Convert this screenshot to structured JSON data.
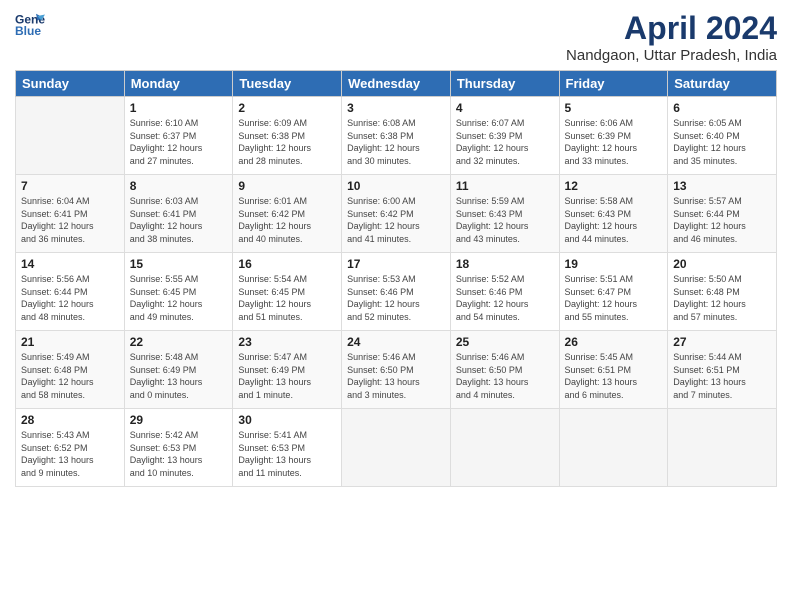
{
  "header": {
    "logo_line1": "General",
    "logo_line2": "Blue",
    "month": "April 2024",
    "location": "Nandgaon, Uttar Pradesh, India"
  },
  "columns": [
    "Sunday",
    "Monday",
    "Tuesday",
    "Wednesday",
    "Thursday",
    "Friday",
    "Saturday"
  ],
  "weeks": [
    [
      {
        "day": "",
        "info": ""
      },
      {
        "day": "1",
        "info": "Sunrise: 6:10 AM\nSunset: 6:37 PM\nDaylight: 12 hours\nand 27 minutes."
      },
      {
        "day": "2",
        "info": "Sunrise: 6:09 AM\nSunset: 6:38 PM\nDaylight: 12 hours\nand 28 minutes."
      },
      {
        "day": "3",
        "info": "Sunrise: 6:08 AM\nSunset: 6:38 PM\nDaylight: 12 hours\nand 30 minutes."
      },
      {
        "day": "4",
        "info": "Sunrise: 6:07 AM\nSunset: 6:39 PM\nDaylight: 12 hours\nand 32 minutes."
      },
      {
        "day": "5",
        "info": "Sunrise: 6:06 AM\nSunset: 6:39 PM\nDaylight: 12 hours\nand 33 minutes."
      },
      {
        "day": "6",
        "info": "Sunrise: 6:05 AM\nSunset: 6:40 PM\nDaylight: 12 hours\nand 35 minutes."
      }
    ],
    [
      {
        "day": "7",
        "info": "Sunrise: 6:04 AM\nSunset: 6:41 PM\nDaylight: 12 hours\nand 36 minutes."
      },
      {
        "day": "8",
        "info": "Sunrise: 6:03 AM\nSunset: 6:41 PM\nDaylight: 12 hours\nand 38 minutes."
      },
      {
        "day": "9",
        "info": "Sunrise: 6:01 AM\nSunset: 6:42 PM\nDaylight: 12 hours\nand 40 minutes."
      },
      {
        "day": "10",
        "info": "Sunrise: 6:00 AM\nSunset: 6:42 PM\nDaylight: 12 hours\nand 41 minutes."
      },
      {
        "day": "11",
        "info": "Sunrise: 5:59 AM\nSunset: 6:43 PM\nDaylight: 12 hours\nand 43 minutes."
      },
      {
        "day": "12",
        "info": "Sunrise: 5:58 AM\nSunset: 6:43 PM\nDaylight: 12 hours\nand 44 minutes."
      },
      {
        "day": "13",
        "info": "Sunrise: 5:57 AM\nSunset: 6:44 PM\nDaylight: 12 hours\nand 46 minutes."
      }
    ],
    [
      {
        "day": "14",
        "info": "Sunrise: 5:56 AM\nSunset: 6:44 PM\nDaylight: 12 hours\nand 48 minutes."
      },
      {
        "day": "15",
        "info": "Sunrise: 5:55 AM\nSunset: 6:45 PM\nDaylight: 12 hours\nand 49 minutes."
      },
      {
        "day": "16",
        "info": "Sunrise: 5:54 AM\nSunset: 6:45 PM\nDaylight: 12 hours\nand 51 minutes."
      },
      {
        "day": "17",
        "info": "Sunrise: 5:53 AM\nSunset: 6:46 PM\nDaylight: 12 hours\nand 52 minutes."
      },
      {
        "day": "18",
        "info": "Sunrise: 5:52 AM\nSunset: 6:46 PM\nDaylight: 12 hours\nand 54 minutes."
      },
      {
        "day": "19",
        "info": "Sunrise: 5:51 AM\nSunset: 6:47 PM\nDaylight: 12 hours\nand 55 minutes."
      },
      {
        "day": "20",
        "info": "Sunrise: 5:50 AM\nSunset: 6:48 PM\nDaylight: 12 hours\nand 57 minutes."
      }
    ],
    [
      {
        "day": "21",
        "info": "Sunrise: 5:49 AM\nSunset: 6:48 PM\nDaylight: 12 hours\nand 58 minutes."
      },
      {
        "day": "22",
        "info": "Sunrise: 5:48 AM\nSunset: 6:49 PM\nDaylight: 13 hours\nand 0 minutes."
      },
      {
        "day": "23",
        "info": "Sunrise: 5:47 AM\nSunset: 6:49 PM\nDaylight: 13 hours\nand 1 minute."
      },
      {
        "day": "24",
        "info": "Sunrise: 5:46 AM\nSunset: 6:50 PM\nDaylight: 13 hours\nand 3 minutes."
      },
      {
        "day": "25",
        "info": "Sunrise: 5:46 AM\nSunset: 6:50 PM\nDaylight: 13 hours\nand 4 minutes."
      },
      {
        "day": "26",
        "info": "Sunrise: 5:45 AM\nSunset: 6:51 PM\nDaylight: 13 hours\nand 6 minutes."
      },
      {
        "day": "27",
        "info": "Sunrise: 5:44 AM\nSunset: 6:51 PM\nDaylight: 13 hours\nand 7 minutes."
      }
    ],
    [
      {
        "day": "28",
        "info": "Sunrise: 5:43 AM\nSunset: 6:52 PM\nDaylight: 13 hours\nand 9 minutes."
      },
      {
        "day": "29",
        "info": "Sunrise: 5:42 AM\nSunset: 6:53 PM\nDaylight: 13 hours\nand 10 minutes."
      },
      {
        "day": "30",
        "info": "Sunrise: 5:41 AM\nSunset: 6:53 PM\nDaylight: 13 hours\nand 11 minutes."
      },
      {
        "day": "",
        "info": ""
      },
      {
        "day": "",
        "info": ""
      },
      {
        "day": "",
        "info": ""
      },
      {
        "day": "",
        "info": ""
      }
    ]
  ]
}
